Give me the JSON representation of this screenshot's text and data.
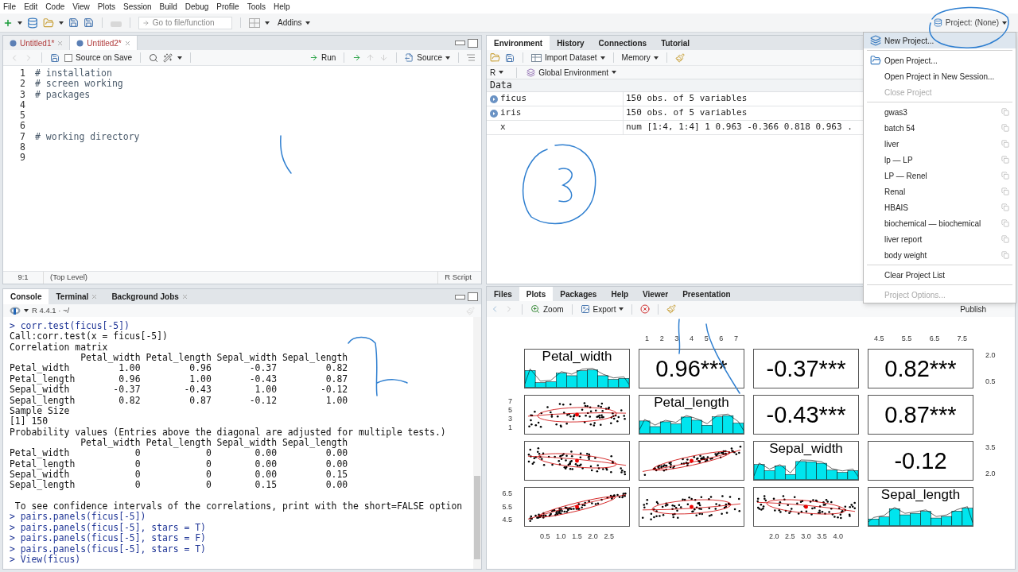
{
  "menu_bar": [
    "File",
    "Edit",
    "Code",
    "View",
    "Plots",
    "Session",
    "Build",
    "Debug",
    "Profile",
    "Tools",
    "Help"
  ],
  "main_toolbar": {
    "search_placeholder": "Go to file/function",
    "addins": "Addins",
    "project": "Project: (None)"
  },
  "editor": {
    "tabs": [
      {
        "label": "Untitled1*",
        "selected": false
      },
      {
        "label": "Untitled2*",
        "selected": true
      }
    ],
    "source_on_save": {
      "label": "Source on Save",
      "checked": false
    },
    "run": "Run",
    "source": "Source",
    "lines": [
      {
        "number": "1",
        "code": "# installation"
      },
      {
        "number": "2",
        "code": "# screen working"
      },
      {
        "number": "3",
        "code": "# packages"
      },
      {
        "number": "4"
      },
      {
        "number": "5"
      },
      {
        "number": "6"
      },
      {
        "number": "7",
        "code": "# working directory"
      },
      {
        "number": "8"
      },
      {
        "number": "9"
      }
    ],
    "status": {
      "position": "9:1",
      "scope": "(Top Level)",
      "file_type": "R Script"
    }
  },
  "environment": {
    "tabs": [
      {
        "label": "Environment",
        "selected": true
      },
      {
        "label": "History",
        "selected": false
      },
      {
        "label": "Connections",
        "selected": false
      },
      {
        "label": "Tutorial",
        "selected": false
      }
    ],
    "import_dataset": "Import Dataset",
    "memory": "Memory",
    "language": "R",
    "scope": "Global Environment",
    "section": "Data",
    "rows": [
      {
        "name": "ficus",
        "value": "150 obs. of 5 variables",
        "expandable": true
      },
      {
        "name": "iris",
        "value": "150 obs. of 5 variables",
        "expandable": true
      },
      {
        "name": "x",
        "value": "num [1:4, 1:4] 1 0.963 -0.366 0.818 0.963 .",
        "expandable": false
      }
    ]
  },
  "project_menu": {
    "items": [
      {
        "kind": "new",
        "label": "New Project...",
        "selected": true,
        "disabled": false
      },
      {
        "kind": "separator"
      },
      {
        "kind": "open",
        "label": "Open Project...",
        "selected": false,
        "disabled": false
      },
      {
        "kind": "action",
        "label": "Open Project in New Session...",
        "selected": false,
        "disabled": false
      },
      {
        "kind": "action",
        "label": "Close Project",
        "selected": false,
        "disabled": true
      },
      {
        "kind": "separator"
      },
      {
        "kind": "recent",
        "label": "gwas3",
        "selected": false,
        "disabled": false
      },
      {
        "kind": "recent",
        "label": "batch 54",
        "selected": false,
        "disabled": false
      },
      {
        "kind": "recent",
        "label": "liver",
        "selected": false,
        "disabled": false
      },
      {
        "kind": "recent",
        "label": "lp — LP",
        "selected": false,
        "disabled": false
      },
      {
        "kind": "recent",
        "label": "LP — Renel",
        "selected": false,
        "disabled": false
      },
      {
        "kind": "recent",
        "label": "Renal",
        "selected": false,
        "disabled": false
      },
      {
        "kind": "recent",
        "label": "HBAIS",
        "selected": false,
        "disabled": false
      },
      {
        "kind": "recent",
        "label": "biochemical — biochemical",
        "selected": false,
        "disabled": false
      },
      {
        "kind": "recent",
        "label": "liver report",
        "selected": false,
        "disabled": false
      },
      {
        "kind": "recent",
        "label": "body weight",
        "selected": false,
        "disabled": false
      },
      {
        "kind": "separator"
      },
      {
        "kind": "action",
        "label": "Clear Project List",
        "selected": false,
        "disabled": false
      },
      {
        "kind": "separator"
      },
      {
        "kind": "action",
        "label": "Project Options...",
        "selected": false,
        "disabled": true
      }
    ]
  },
  "console": {
    "tabs": [
      {
        "label": "Console",
        "selected": true,
        "closable": false
      },
      {
        "label": "Terminal",
        "selected": false,
        "closable": true
      },
      {
        "label": "Background Jobs",
        "selected": false,
        "closable": true
      }
    ],
    "session": "R 4.4.1 · ~/",
    "lines": [
      {
        "kind": "input",
        "text": "> corr.test(ficus[-5])"
      },
      {
        "kind": "output",
        "text": "Call:corr.test(x = ficus[-5])"
      },
      {
        "kind": "output",
        "text": "Correlation matrix"
      },
      {
        "kind": "output",
        "text": "             Petal_width Petal_length Sepal_width Sepal_length"
      },
      {
        "kind": "output",
        "text": "Petal_width         1.00         0.96       -0.37         0.82"
      },
      {
        "kind": "output",
        "text": "Petal_length        0.96         1.00       -0.43         0.87"
      },
      {
        "kind": "output",
        "text": "Sepal_width        -0.37        -0.43        1.00        -0.12"
      },
      {
        "kind": "output",
        "text": "Sepal_length        0.82         0.87       -0.12         1.00"
      },
      {
        "kind": "output",
        "text": "Sample Size"
      },
      {
        "kind": "output",
        "text": "[1] 150"
      },
      {
        "kind": "output",
        "text": "Probability values (Entries above the diagonal are adjusted for multiple tests.)"
      },
      {
        "kind": "output",
        "text": "             Petal_width Petal_length Sepal_width Sepal_length"
      },
      {
        "kind": "output",
        "text": "Petal_width            0            0        0.00         0.00"
      },
      {
        "kind": "output",
        "text": "Petal_length           0            0        0.00         0.00"
      },
      {
        "kind": "output",
        "text": "Sepal_width            0            0        0.00         0.15"
      },
      {
        "kind": "output",
        "text": "Sepal_length           0            0        0.15         0.00"
      },
      {
        "kind": "blank"
      },
      {
        "kind": "output",
        "text": " To see confidence intervals of the correlations, print with the short=FALSE option"
      },
      {
        "kind": "input",
        "text": "> pairs.panels(ficus[-5])"
      },
      {
        "kind": "input",
        "text": "> pairs.panels(ficus[-5], stars = T)"
      },
      {
        "kind": "input",
        "text": "> pairs.panels(ficus[-5], stars = F)"
      },
      {
        "kind": "input",
        "text": "> pairs.panels(ficus[-5], stars = T)"
      },
      {
        "kind": "input",
        "text": "> View(ficus)"
      }
    ]
  },
  "plots_pane": {
    "tabs": [
      {
        "label": "Files",
        "selected": false
      },
      {
        "label": "Plots",
        "selected": true
      },
      {
        "label": "Packages",
        "selected": false
      },
      {
        "label": "Help",
        "selected": false
      },
      {
        "label": "Viewer",
        "selected": false
      },
      {
        "label": "Presentation",
        "selected": false
      }
    ],
    "zoom": "Zoom",
    "export": "Export",
    "publish": "Publish",
    "pairs_plot": {
      "panels": [
        [
          {
            "kind": "histogram",
            "label": "Petal_width"
          },
          {
            "kind": "correlation",
            "text": "0.96***"
          },
          {
            "kind": "correlation",
            "text": "-0.37***"
          },
          {
            "kind": "correlation",
            "text": "0.82***"
          }
        ],
        [
          {
            "kind": "scatter"
          },
          {
            "kind": "histogram",
            "label": "Petal_length"
          },
          {
            "kind": "correlation",
            "text": "-0.43***"
          },
          {
            "kind": "correlation",
            "text": "0.87***"
          }
        ],
        [
          {
            "kind": "scatter"
          },
          {
            "kind": "scatter"
          },
          {
            "kind": "histogram",
            "label": "Sepal_width"
          },
          {
            "kind": "correlation",
            "text": "-0.12"
          }
        ],
        [
          {
            "kind": "scatter"
          },
          {
            "kind": "scatter"
          },
          {
            "kind": "scatter"
          },
          {
            "kind": "histogram",
            "label": "Sepal_length"
          }
        ]
      ],
      "column_axes": [
        {
          "bottom_ticks": [
            "0.5",
            "1.0",
            "1.5",
            "2.0",
            "2.5"
          ]
        },
        {
          "top_ticks": [
            "1",
            "2",
            "3",
            "4",
            "5",
            "6",
            "7"
          ]
        },
        {
          "bottom_ticks": [
            "2.0",
            "2.5",
            "3.0",
            "3.5",
            "4.0"
          ]
        },
        {
          "top_ticks": [
            "4.5",
            "5.5",
            "6.5",
            "7.5"
          ]
        }
      ],
      "row_axes": [
        {
          "right_ticks": [
            "2.0",
            "0.5"
          ]
        },
        {
          "left_ticks": [
            "7",
            "5",
            "3",
            "1"
          ]
        },
        {
          "right_ticks": [
            "3.5",
            "2.0"
          ]
        },
        {
          "left_ticks": [
            "6.5",
            "5.5",
            "4.5"
          ]
        }
      ]
    }
  }
}
